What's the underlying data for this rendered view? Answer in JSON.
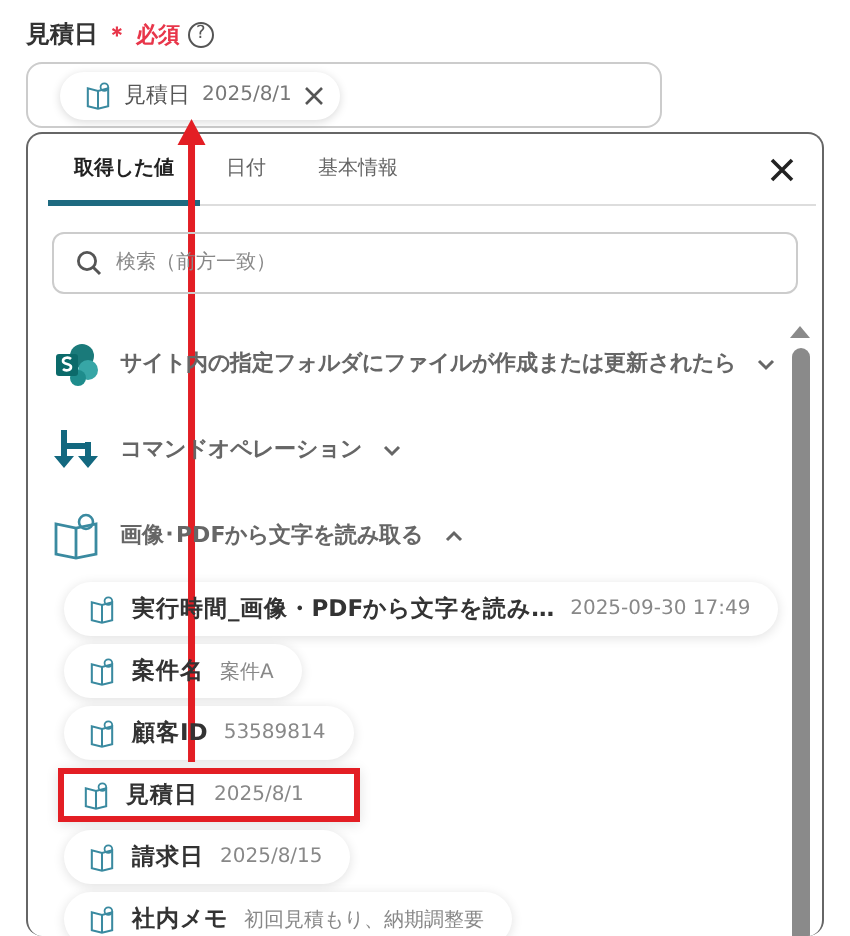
{
  "field": {
    "label": "見積日",
    "required_mark": "＊",
    "required_text": "必須",
    "help": "?",
    "chip": {
      "name": "見積日",
      "value": "2025/8/1"
    }
  },
  "picker": {
    "tabs": [
      {
        "label": "取得した値",
        "selected": true
      },
      {
        "label": "日付",
        "selected": false
      },
      {
        "label": "基本情報",
        "selected": false
      }
    ],
    "search": {
      "placeholder": "検索（前方一致）"
    },
    "groups": [
      {
        "kind": "sharepoint",
        "title": "サイト内の指定フォルダにファイルが作成または更新されたら",
        "expanded": false
      },
      {
        "kind": "command",
        "title": "コマンドオペレーション",
        "expanded": false
      },
      {
        "kind": "ocr",
        "title": "画像･PDFから文字を読み取る",
        "expanded": true,
        "items": [
          {
            "name": "実行時間_画像・PDFから文字を読み…",
            "value": "2025-09-30 17:49",
            "highlighted": false
          },
          {
            "name": "案件名",
            "value": "案件A",
            "highlighted": false
          },
          {
            "name": "顧客ID",
            "value": "53589814",
            "highlighted": false
          },
          {
            "name": "見積日",
            "value": "2025/8/1",
            "highlighted": true
          },
          {
            "name": "請求日",
            "value": "2025/8/15",
            "highlighted": false
          },
          {
            "name": "社内メモ",
            "value": "初回見積もり、納期調整要",
            "highlighted": false
          }
        ]
      }
    ]
  }
}
